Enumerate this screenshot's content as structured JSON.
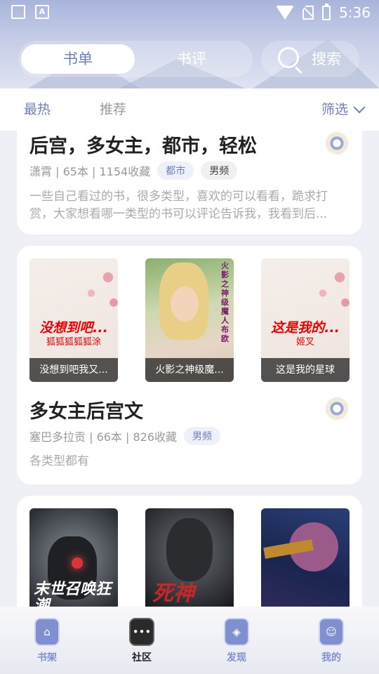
{
  "status_bar": {
    "time": "5:36",
    "left_icons": [
      "image-icon",
      "a-icon"
    ]
  },
  "header": {
    "tabs": [
      {
        "label": "书单",
        "active": true
      },
      {
        "label": "书评",
        "active": false
      }
    ],
    "search_label": "搜索"
  },
  "filter_bar": {
    "hot": "最热",
    "recommend": "推荐",
    "filter": "筛选"
  },
  "cards": [
    {
      "title": "后宫，多女主，都市，轻松",
      "meta": "潇霄 | 65本 | 1154收藏",
      "tags": [
        "都市",
        "男频"
      ],
      "desc": "一些自己看过的书，很多类型，喜欢的可以看看，跪求打赏，大家想看哪一类型的书可以评论告诉我，我看到后..."
    },
    {
      "books": [
        {
          "caption": "没想到吧我又...",
          "cover_title": "没想到吧...",
          "cover_sub": "狐狐狐狐狐涂"
        },
        {
          "caption": "火影之神级魔...",
          "cover_title": "火影之神级魔人布欧",
          "cover_sub": ""
        },
        {
          "caption": "这是我的星球",
          "cover_title": "这是我的...",
          "cover_sub": "姬叉"
        }
      ],
      "title": "多女主后宫文",
      "meta": "塞巴多拉贡 | 66本 | 826收藏",
      "tags": [
        "男频"
      ],
      "desc": "各类型都有"
    },
    {
      "books": [
        {
          "cover_title": "末世召唤狂潮"
        },
        {
          "cover_title": "死神"
        },
        {
          "cover_title": ""
        }
      ]
    }
  ],
  "bottom_nav": [
    {
      "label": "书架",
      "icon": "home-icon",
      "active": false
    },
    {
      "label": "社区",
      "icon": "chat-icon",
      "active": true
    },
    {
      "label": "发现",
      "icon": "compass-icon",
      "active": false
    },
    {
      "label": "我的",
      "icon": "user-icon",
      "active": false
    }
  ],
  "colors": {
    "accent": "#6f7fc1",
    "header": "#a9b4db"
  }
}
